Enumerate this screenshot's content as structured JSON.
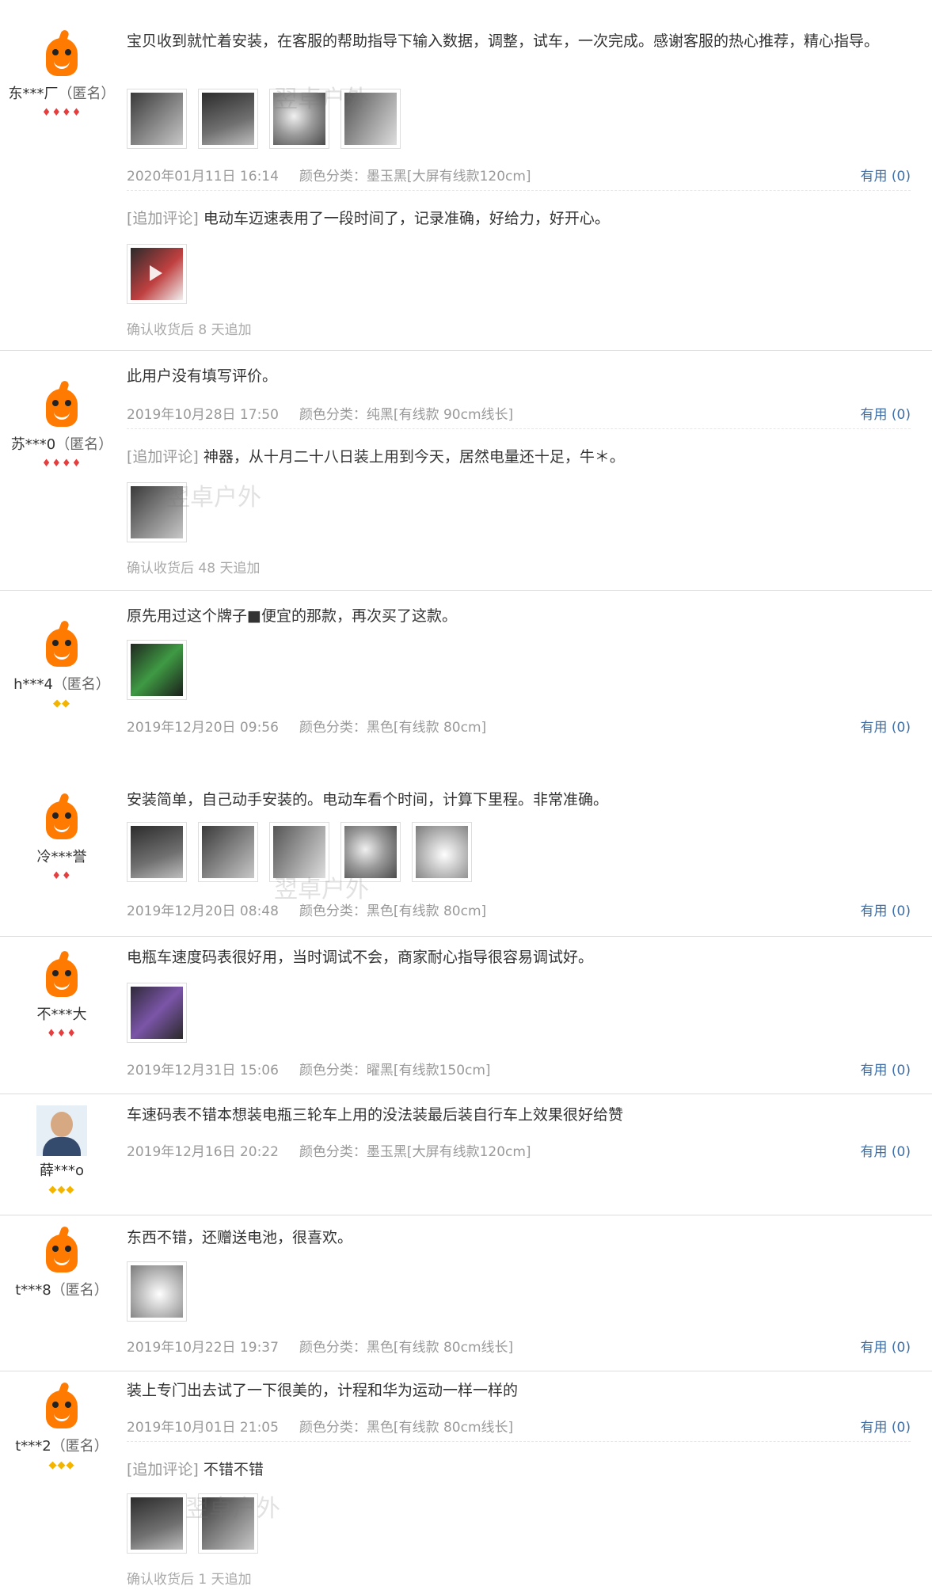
{
  "badges": {
    "red": "♦",
    "gold": "◆"
  },
  "watermark": "翌卓户外",
  "reviews": [
    {
      "user": {
        "name": "东***厂",
        "anon": "（匿名）"
      },
      "text": "宝贝收到就忙着安装，在客服的帮助指导下输入数据，调整，试车，一次完成。感谢客服的热心推荐，精心指导。",
      "date": "2020年01月11日 16:14",
      "sku": "颜色分类：墨玉黑[大屏有线款120cm]",
      "useful": "有用 (0)",
      "append_tag": "[追加评论]",
      "append_text": "电动车迈速表用了一段时间了，记录准确，好给力，好开心。",
      "after": "确认收货后 8 天追加"
    },
    {
      "user": {
        "name": "苏***0",
        "anon": "（匿名）"
      },
      "text": "此用户没有填写评价。",
      "date": "2019年10月28日 17:50",
      "sku": "颜色分类：纯黑[有线款 90cm线长]",
      "useful": "有用 (0)",
      "append_tag": "[追加评论]",
      "append_text": "神器，从十月二十八日装上用到今天，居然电量还十足，牛＊。",
      "after": "确认收货后 48 天追加"
    },
    {
      "user": {
        "name": "h***4",
        "anon": "（匿名）"
      },
      "text": "原先用过这个牌子■便宜的那款，再次买了这款。",
      "date": "2019年12月20日 09:56",
      "sku": "颜色分类：黑色[有线款 80cm]",
      "useful": "有用 (0)"
    },
    {
      "user": {
        "name": "冷***誉",
        "anon": ""
      },
      "text": "安装简单，自己动手安装的。电动车看个时间，计算下里程。非常准确。",
      "date": "2019年12月20日 08:48",
      "sku": "颜色分类：黑色[有线款 80cm]",
      "useful": "有用 (0)"
    },
    {
      "user": {
        "name": "不***大",
        "anon": ""
      },
      "text": "电瓶车速度码表很好用，当时调试不会，商家耐心指导很容易调试好。",
      "date": "2019年12月31日 15:06",
      "sku": "颜色分类：曜黑[有线款150cm]",
      "useful": "有用 (0)"
    },
    {
      "user": {
        "name": "薛***o",
        "anon": ""
      },
      "text": "车速码表不错本想装电瓶三轮车上用的没法装最后装自行车上效果很好给赞",
      "date": "2019年12月16日 20:22",
      "sku": "颜色分类：墨玉黑[大屏有线款120cm]",
      "useful": "有用 (0)"
    },
    {
      "user": {
        "name": "t***8",
        "anon": "（匿名）"
      },
      "text": "东西不错，还赠送电池，很喜欢。",
      "date": "2019年10月22日 19:37",
      "sku": "颜色分类：黑色[有线款 80cm线长]",
      "useful": "有用 (0)"
    },
    {
      "user": {
        "name": "t***2",
        "anon": "（匿名）"
      },
      "text": "装上专门出去试了一下很美的，计程和华为运动一样一样的",
      "date": "2019年10月01日 21:05",
      "sku": "颜色分类：黑色[有线款 80cm线长]",
      "useful": "有用 (0)",
      "append_tag": "[追加评论]",
      "append_text": "不错不错",
      "after": "确认收货后 1 天追加"
    }
  ]
}
